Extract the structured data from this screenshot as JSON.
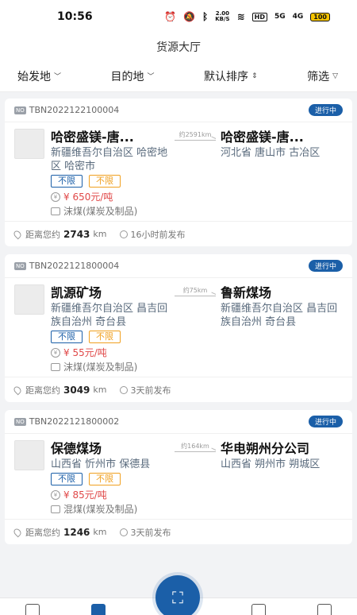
{
  "status_bar": {
    "time": "10:56",
    "speed": "2.00\nKB/S",
    "hd": "HD",
    "signal1": "5G",
    "signal2": "4G",
    "battery": "100"
  },
  "header": {
    "title": "货源大厅"
  },
  "filters": [
    {
      "label": "始发地",
      "icon": "chevron-down-icon"
    },
    {
      "label": "目的地",
      "icon": "chevron-down-icon"
    },
    {
      "label": "默认排序",
      "icon": "sort-icon"
    },
    {
      "label": "筛选",
      "icon": "filter-icon"
    }
  ],
  "common": {
    "no_tag": "NO",
    "distance_prefix": "距离您约",
    "distance_unit": "km"
  },
  "cards": [
    {
      "order_no": "TBN2022122100004",
      "status": "进行中",
      "origin_company": "哈密盛镁-唐...",
      "origin_address": "新疆维吾尔自治区 哈密地区 哈密市",
      "tag1": "不限",
      "tag2": "不限",
      "price": "¥ 650元/吨",
      "cargo": "沫煤(煤炭及制品)",
      "route_distance": "约2591km",
      "dest_company": "哈密盛镁-唐...",
      "dest_address": "河北省 唐山市 古冶区",
      "distance": "2743",
      "time_ago": "16小时前发布"
    },
    {
      "order_no": "TBN2022121800004",
      "status": "进行中",
      "origin_company": "凯源矿场",
      "origin_address": "新疆维吾尔自治区 昌吉回族自治州 奇台县",
      "tag1": "不限",
      "tag2": "不限",
      "price": "¥ 55元/吨",
      "cargo": "沫煤(煤炭及制品)",
      "route_distance": "约75km",
      "dest_company": "鲁新煤场",
      "dest_address": "新疆维吾尔自治区 昌吉回族自治州 奇台县",
      "distance": "3049",
      "time_ago": "3天前发布"
    },
    {
      "order_no": "TBN2022121800002",
      "status": "进行中",
      "origin_company": "保德煤场",
      "origin_address": "山西省 忻州市 保德县",
      "tag1": "不限",
      "tag2": "不限",
      "price": "¥ 85元/吨",
      "cargo": "混煤(煤炭及制品)",
      "route_distance": "约164km",
      "dest_company": "华电朔州分公司",
      "dest_address": "山西省 朔州市 朔城区",
      "distance": "1246",
      "time_ago": "3天前发布"
    }
  ],
  "bottom_nav": {
    "scan_icon": "scan-icon"
  },
  "colors": {
    "accent": "#1b5fa8",
    "price": "#e04848",
    "tag_orange": "#f0a020"
  }
}
